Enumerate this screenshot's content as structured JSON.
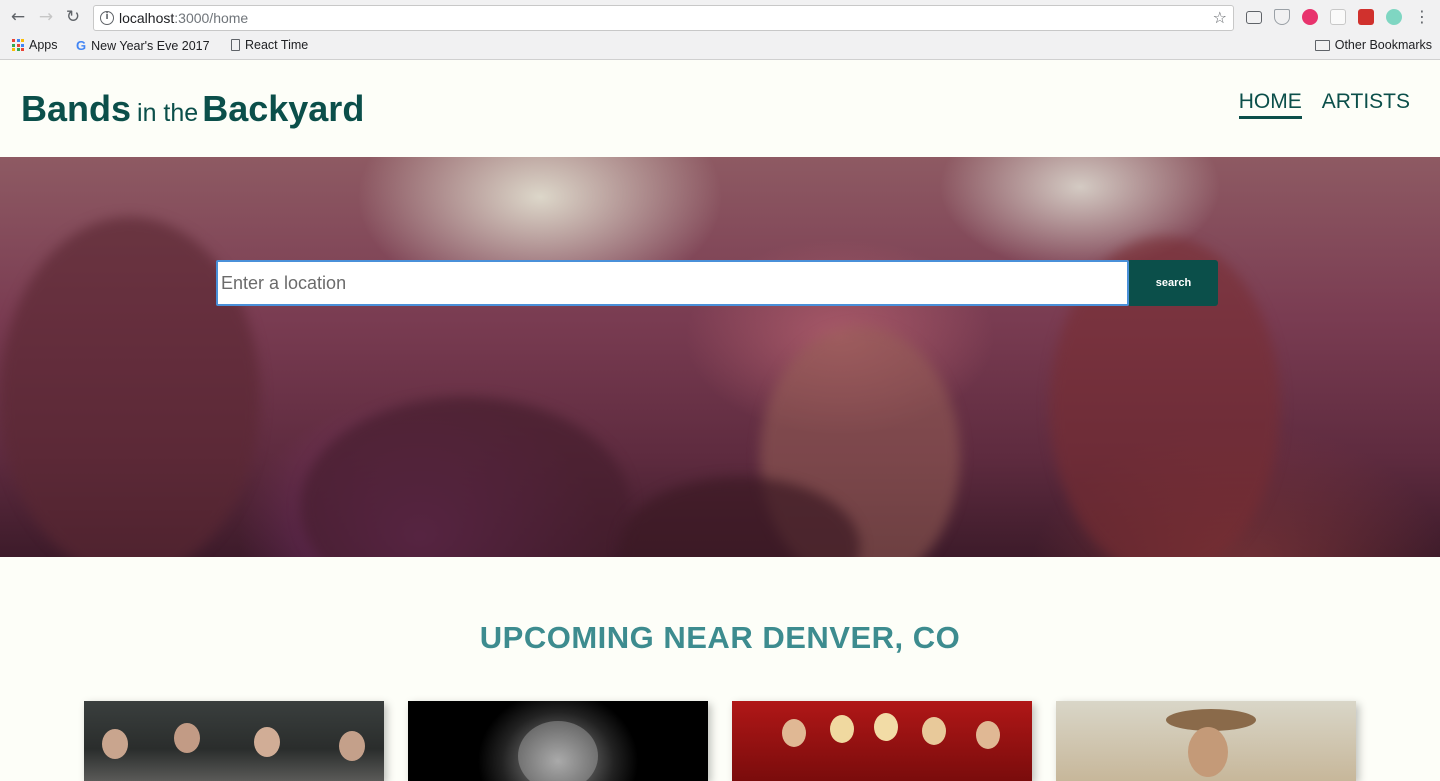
{
  "browser": {
    "url_host": "localhost",
    "url_path": ":3000/home",
    "bookmarks": [
      {
        "label": "Apps",
        "icon": "apps-grid-icon"
      },
      {
        "label": "New Year's Eve 2017",
        "icon": "google-icon"
      },
      {
        "label": "React Time",
        "icon": "page-icon"
      }
    ],
    "other_bookmarks": "Other Bookmarks"
  },
  "site": {
    "logo_word1": "Bands",
    "logo_connector": "in the",
    "logo_word2": "Backyard",
    "nav": [
      {
        "label": "HOME",
        "active": true
      },
      {
        "label": "ARTISTS",
        "active": false
      }
    ]
  },
  "search": {
    "placeholder": "Enter a location",
    "button_label": "search"
  },
  "upcoming": {
    "title": "UPCOMING NEAR DENVER, CO",
    "cards": [
      {
        "icon": "band-photo-group"
      },
      {
        "icon": "artist-photo-bw"
      },
      {
        "icon": "band-photo-red"
      },
      {
        "icon": "artist-photo-cowboy"
      }
    ]
  },
  "colors": {
    "brand": "#0b4f4a",
    "heading": "#3d8c8f",
    "page_bg": "#fdfef8"
  }
}
